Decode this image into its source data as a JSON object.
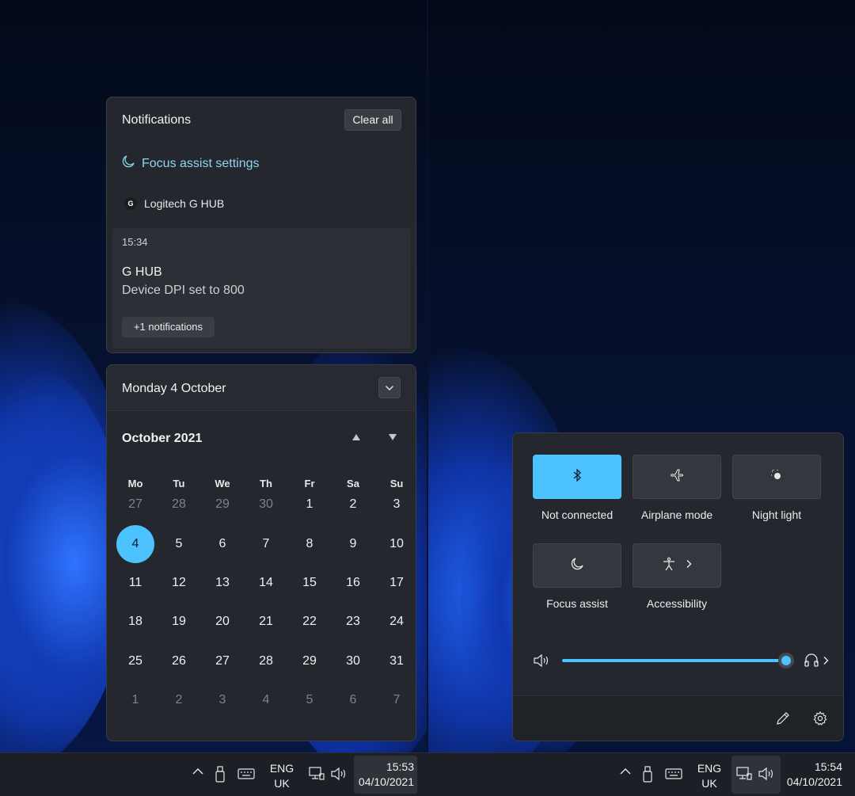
{
  "notifications": {
    "title": "Notifications",
    "clear_all_label": "Clear all",
    "focus_assist_link": "Focus assist settings",
    "app_name": "Logitech G HUB",
    "app_logo_letter": "G",
    "toast": {
      "time": "15:34",
      "title": "G HUB",
      "body": "Device DPI set to 800",
      "more_label": "+1 notifications"
    }
  },
  "calendar": {
    "header_date": "Monday 4 October",
    "month_label": "October 2021",
    "weekdays": [
      "Mo",
      "Tu",
      "We",
      "Th",
      "Fr",
      "Sa",
      "Su"
    ],
    "weeks": [
      [
        "27",
        "28",
        "29",
        "30",
        "1",
        "2",
        "3"
      ],
      [
        "4",
        "5",
        "6",
        "7",
        "8",
        "9",
        "10"
      ],
      [
        "11",
        "12",
        "13",
        "14",
        "15",
        "16",
        "17"
      ],
      [
        "18",
        "19",
        "20",
        "21",
        "22",
        "23",
        "24"
      ],
      [
        "25",
        "26",
        "27",
        "28",
        "29",
        "30",
        "31"
      ],
      [
        "1",
        "2",
        "3",
        "4",
        "5",
        "6",
        "7"
      ]
    ],
    "today": "4"
  },
  "quick_settings": {
    "tiles": [
      {
        "label": "Not connected",
        "icon": "bluetooth-icon",
        "active": true
      },
      {
        "label": "Airplane mode",
        "icon": "airplane-icon",
        "active": false
      },
      {
        "label": "Night light",
        "icon": "night-light-icon",
        "active": false
      },
      {
        "label": "Focus assist",
        "icon": "moon-icon",
        "active": false
      },
      {
        "label": "Accessibility",
        "icon": "accessibility-icon",
        "active": false
      }
    ],
    "volume_percent": 100,
    "accent_color": "#4cc2ff"
  },
  "taskbar_left": {
    "lang_line1": "ENG",
    "lang_line2": "UK",
    "time": "15:53",
    "date": "04/10/2021"
  },
  "taskbar_right": {
    "lang_line1": "ENG",
    "lang_line2": "UK",
    "time": "15:54",
    "date": "04/10/2021"
  }
}
